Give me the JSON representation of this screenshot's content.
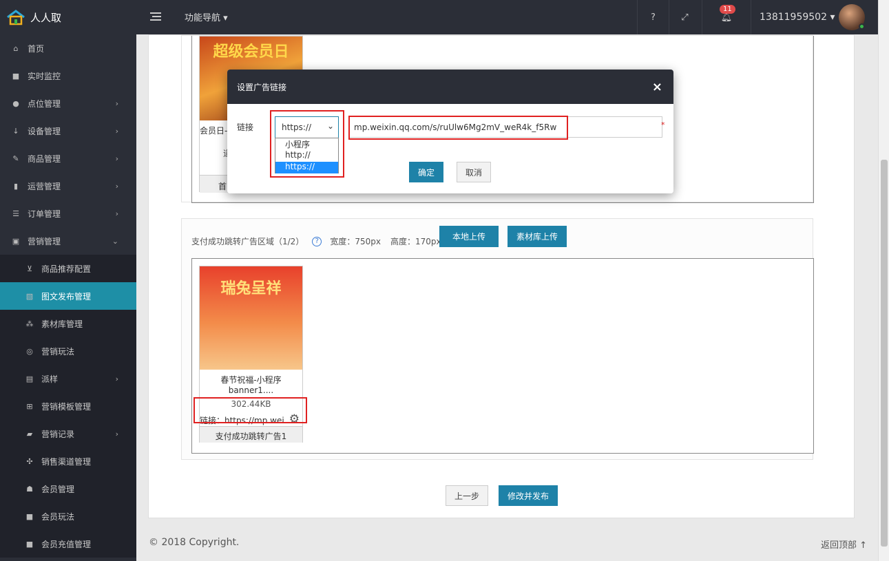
{
  "app": {
    "name": "人人取"
  },
  "topbar": {
    "func_nav": "功能导航",
    "help": "?",
    "bell_count": "11",
    "user": "13811959502"
  },
  "sidebar": {
    "items": [
      {
        "label": "首页",
        "icon": "home-icon"
      },
      {
        "label": "实时监控",
        "icon": "video-icon"
      },
      {
        "label": "点位管理",
        "icon": "pin-icon"
      },
      {
        "label": "设备管理",
        "icon": "sort-icon"
      },
      {
        "label": "商品管理",
        "icon": "edit-icon"
      },
      {
        "label": "运营管理",
        "icon": "bookmark-icon"
      },
      {
        "label": "订单管理",
        "icon": "list-icon"
      },
      {
        "label": "营销管理",
        "icon": "gift-icon"
      }
    ],
    "sub": [
      {
        "label": "商品推荐配置"
      },
      {
        "label": "图文发布管理"
      },
      {
        "label": "素材库管理"
      },
      {
        "label": "营销玩法"
      },
      {
        "label": "派样"
      },
      {
        "label": "营销模板管理"
      },
      {
        "label": "营销记录"
      },
      {
        "label": "销售渠道管理"
      },
      {
        "label": "会员管理"
      },
      {
        "label": "会员玩法"
      },
      {
        "label": "会员充值管理"
      }
    ]
  },
  "upper_card": {
    "thumb_title": "超级会员日",
    "caption": "会员日-",
    "extra": "道",
    "btn": "首"
  },
  "section2": {
    "title": "支付成功跳转广告区域（1/2）",
    "width": "宽度：750px",
    "height": "高度：170px",
    "local_upload": "本地上传",
    "library_upload": "素材库上传",
    "thumb": {
      "art_text": "瑞兔呈祥",
      "name": "春节祝福-小程序banner1....",
      "size": "302.44KB",
      "link": "链接：https://mp.wei..",
      "label": "支付成功跳转广告1"
    }
  },
  "actions": {
    "prev": "上一步",
    "publish": "修改并发布"
  },
  "footer": {
    "copyright": "© 2018 Copyright.",
    "back_top": "返回顶部"
  },
  "modal": {
    "title": "设置广告链接",
    "close": "×",
    "link_label": "链接",
    "protocol_selected": "https://",
    "protocol_options": [
      "小程序",
      "http://",
      "https://"
    ],
    "url_value": "mp.weixin.qq.com/s/ruUlw6Mg2mV_weR4k_f5Rw",
    "required_mark": "*",
    "ok": "确定",
    "cancel": "取消"
  }
}
